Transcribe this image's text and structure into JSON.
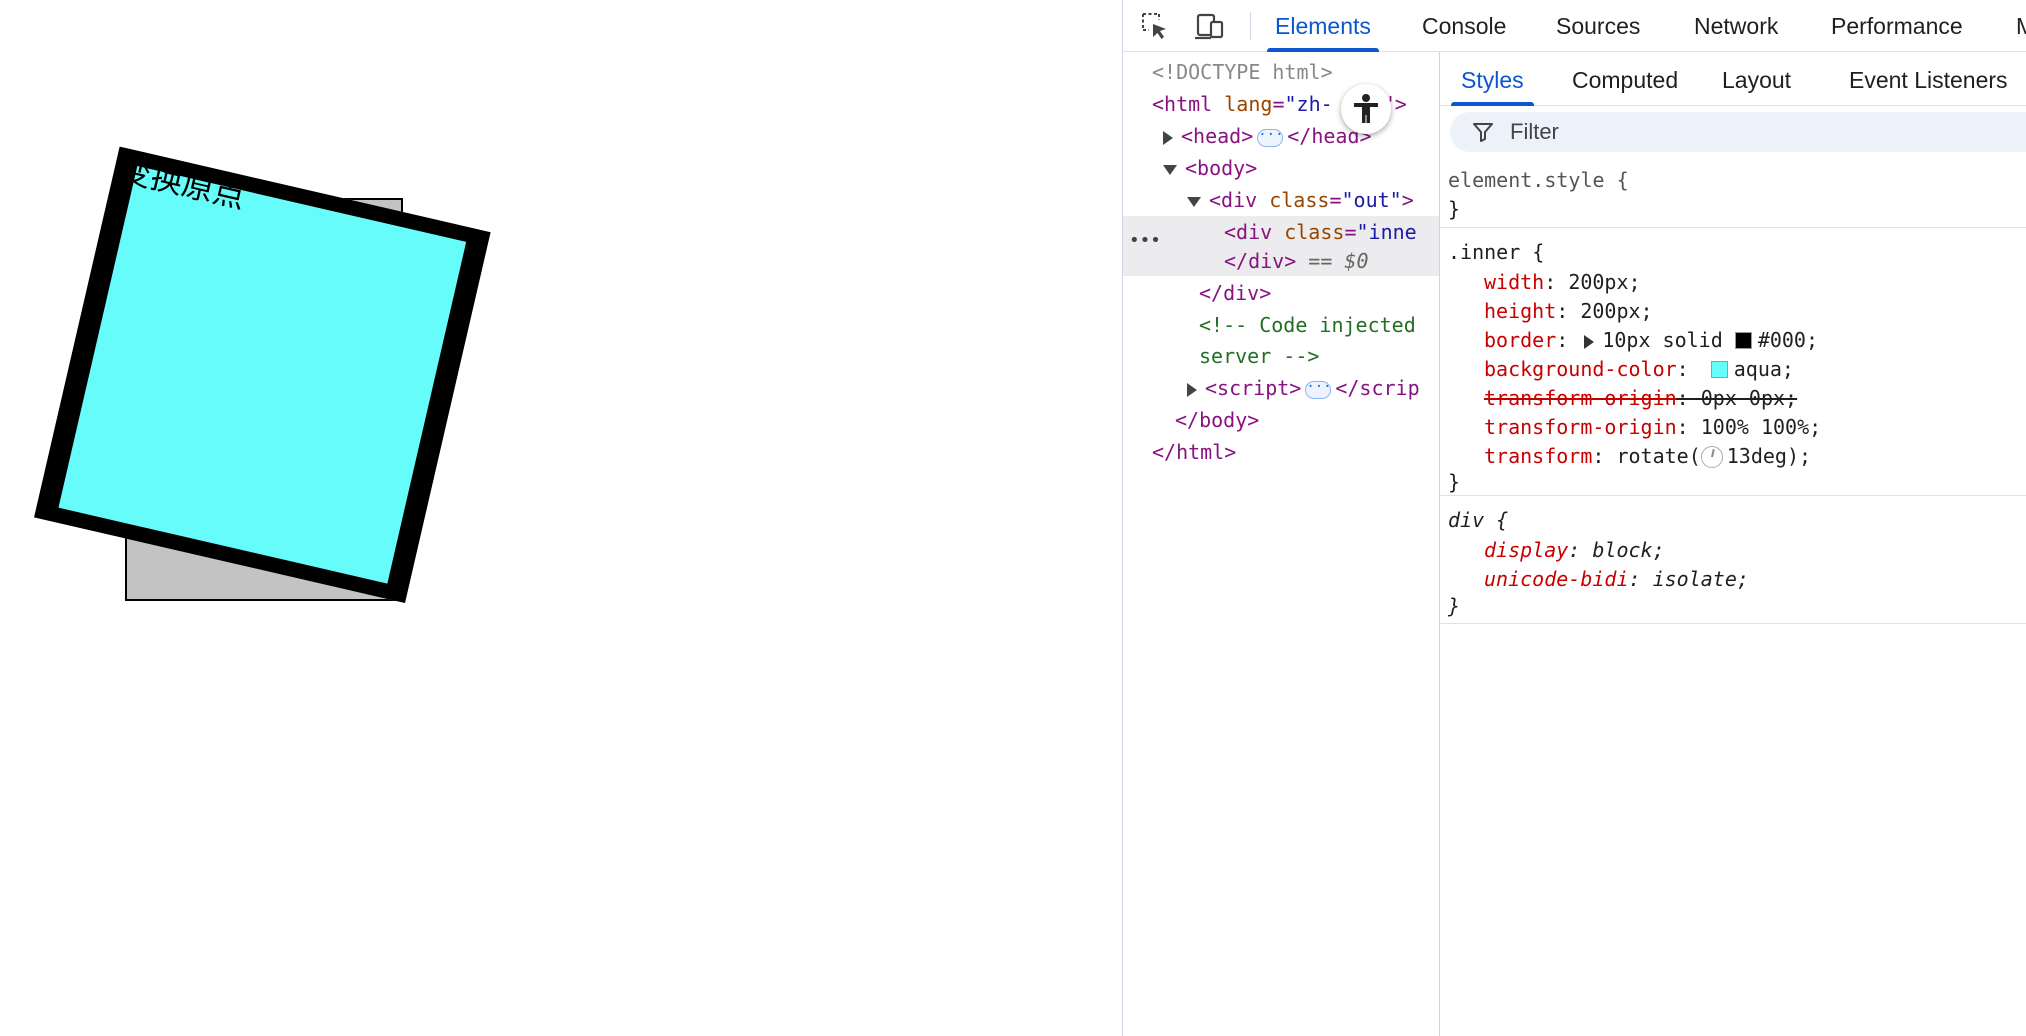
{
  "demo": {
    "label": "变换原点",
    "outer_bg": "#c3c3c3",
    "inner_bg": "#66fcfa",
    "inner_border": "#000000"
  },
  "devtools": {
    "toolbar": {
      "icons": [
        "inspect-element-icon",
        "device-toggle-icon"
      ],
      "tabs": [
        "Elements",
        "Console",
        "Sources",
        "Network",
        "Performance",
        "M"
      ],
      "active_tab": "Elements",
      "accent": "#0b57d0"
    },
    "dom_tree": {
      "doctype": "<!DOCTYPE html>",
      "html_open_tag": "<html",
      "html_lang_attr": "lang",
      "html_lang_val": "\"zh-",
      "html_lang_tail": "\">",
      "head_open": "<head>",
      "head_close": "</head>",
      "body_open": "<body>",
      "div_out_open": "<div",
      "div_out_attr": "class",
      "div_out_val": "\"out\"",
      "div_out_end": ">",
      "div_inner_open": "<div",
      "div_inner_attr": "class",
      "div_inner_val": "\"inne",
      "div_inner_close": "</div>",
      "selected_marker": "== $0",
      "div_out_close": "</div>",
      "comment_line1": "<!-- Code injected",
      "comment_line2": "server -->",
      "script_open": "<script>",
      "script_close": "</scrip",
      "body_close": "</body>",
      "html_close": "</html>",
      "row_dots": "•••"
    },
    "styles": {
      "tabs": [
        "Styles",
        "Computed",
        "Layout",
        "Event Listeners"
      ],
      "active_tab": "Styles",
      "filter_placeholder": "Filter",
      "rules": {
        "element_style": {
          "selector": "element.style {",
          "close": "}"
        },
        "inner": {
          "selector": ".inner {",
          "declarations": [
            {
              "prop": "width",
              "value": "200px;"
            },
            {
              "prop": "height",
              "value": "200px;"
            },
            {
              "prop": "border",
              "value": "10px solid",
              "color_value": "#000;",
              "swatch": "#000000"
            },
            {
              "prop": "background-color",
              "value": "aqua;",
              "swatch": "#66fcfa"
            },
            {
              "prop": "transform-origin",
              "value": "0px 0px;",
              "overridden": true
            },
            {
              "prop": "transform-origin",
              "value": "100% 100%;"
            },
            {
              "prop": "transform",
              "value_prefix": "rotate(",
              "value": "13deg);"
            }
          ],
          "close": "}"
        },
        "div": {
          "selector": "div {",
          "declarations": [
            {
              "prop": "display",
              "value": "block;"
            },
            {
              "prop": "unicode-bidi",
              "value": "isolate;"
            }
          ],
          "close": "}"
        }
      }
    }
  }
}
